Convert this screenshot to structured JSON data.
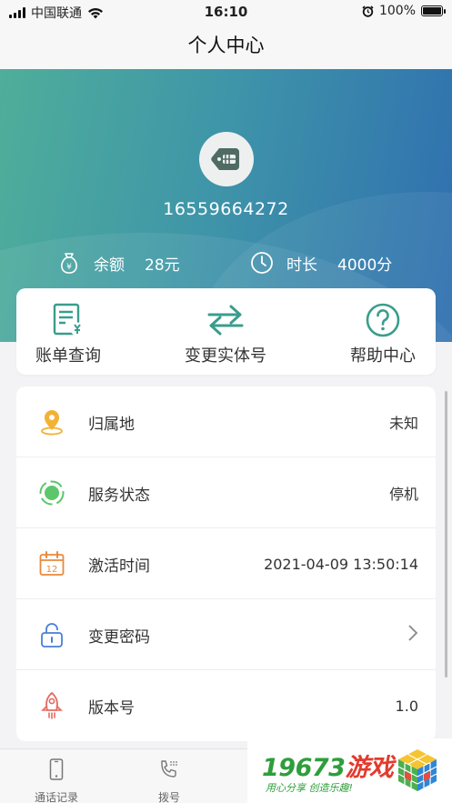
{
  "status_bar": {
    "carrier": "中国联通",
    "time": "16:10",
    "battery": "100%"
  },
  "nav": {
    "title": "个人中心"
  },
  "profile": {
    "phone": "16559664272",
    "balance_label": "余额",
    "balance_value": "28元",
    "duration_label": "时长",
    "duration_value": "4000分"
  },
  "actions": [
    {
      "label": "账单查询",
      "icon": "bill-icon"
    },
    {
      "label": "变更实体号",
      "icon": "swap-arrows-icon"
    },
    {
      "label": "帮助中心",
      "icon": "help-icon"
    }
  ],
  "info_rows": [
    {
      "label": "归属地",
      "value": "未知",
      "icon": "location-pin-icon"
    },
    {
      "label": "服务状态",
      "value": "停机",
      "icon": "status-dot-icon"
    },
    {
      "label": "激活时间",
      "value": "2021-04-09 13:50:14",
      "icon": "calendar-icon"
    },
    {
      "label": "变更密码",
      "value": "",
      "icon": "lock-icon"
    },
    {
      "label": "版本号",
      "value": "1.0",
      "icon": "rocket-icon"
    }
  ],
  "tabs": [
    {
      "label": "通话记录",
      "icon": "phone-device-icon"
    },
    {
      "label": "拨号",
      "icon": "dial-icon"
    }
  ],
  "watermark": {
    "title_green": "19673",
    "title_red": "游戏",
    "subtitle": "用心分享 创造乐趣!"
  },
  "colors": {
    "hero_start": "#4fae9a",
    "hero_end": "#2f6fb0",
    "accent_teal": "#3a9d8c",
    "status_green": "#5cc66b",
    "calendar_orange": "#e88a3a",
    "lock_blue": "#4a7fd6",
    "rocket_red": "#e46b62",
    "pin_yellow": "#f2b233"
  }
}
